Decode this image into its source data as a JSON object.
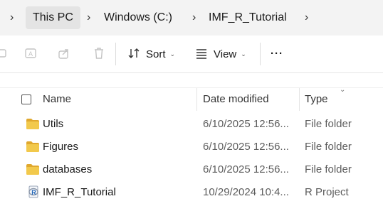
{
  "breadcrumb": {
    "items": [
      "This PC",
      "Windows (C:)",
      "IMF_R_Tutorial"
    ]
  },
  "toolbar": {
    "sort_label": "Sort",
    "view_label": "View",
    "more_label": "···"
  },
  "columns": {
    "name": "Name",
    "date": "Date modified",
    "type": "Type"
  },
  "files": [
    {
      "name": "Utils",
      "date": "6/10/2025 12:56...",
      "type": "File folder",
      "icon": "folder-icon"
    },
    {
      "name": "Figures",
      "date": "6/10/2025 12:56...",
      "type": "File folder",
      "icon": "folder-icon"
    },
    {
      "name": "databases",
      "date": "6/10/2025 12:56...",
      "type": "File folder",
      "icon": "folder-icon"
    },
    {
      "name": "IMF_R_Tutorial",
      "date": "10/29/2024 10:4...",
      "type": "R Project",
      "icon": "r-project-icon"
    }
  ],
  "colors": {
    "folder": "#f2c94c",
    "folder_dark": "#e0a82e",
    "topbar": "#f3f3f3"
  }
}
